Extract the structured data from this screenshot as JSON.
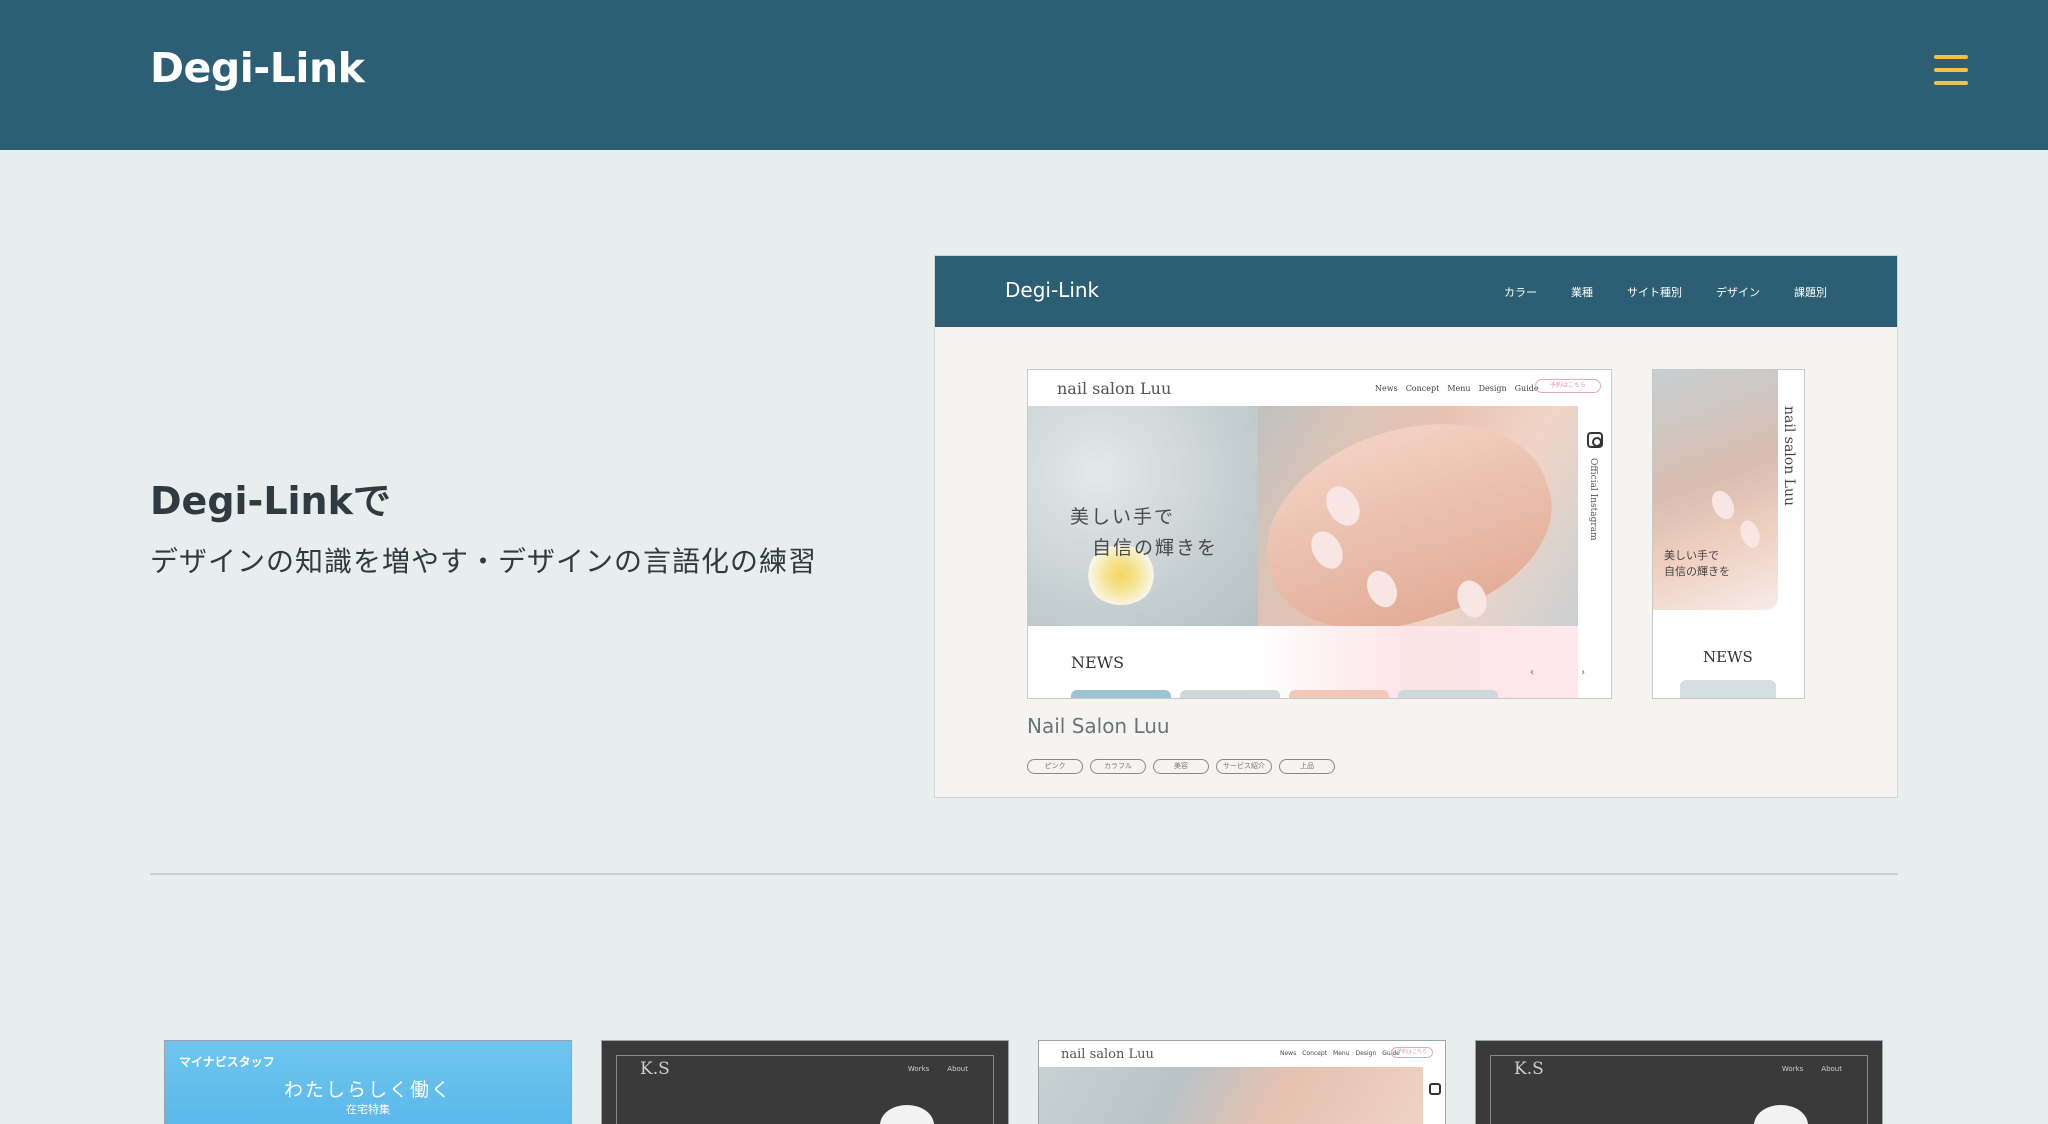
{
  "header": {
    "logo": "Degi-Link",
    "menu_icon": "hamburger-menu-icon",
    "accent_color": "#f0c04a",
    "background_color": "#2c5f74"
  },
  "hero": {
    "title": "Degi-Linkで",
    "subtitle": "デザインの知識を増やす・デザインの言語化の練習"
  },
  "mockup": {
    "site_logo": "Degi-Link",
    "nav": [
      "カラー",
      "業種",
      "サイト種別",
      "デザイン",
      "課題別"
    ],
    "desktop": {
      "brand": "nail salon Luu",
      "nav": [
        "News",
        "Concept",
        "Menu",
        "Design",
        "Guide"
      ],
      "reserve": "予約はこちら",
      "catch_line1": "美しい手で",
      "catch_line2": "自信の輝きを",
      "side_text": "Official Instagram",
      "news_label": "NEWS",
      "arrows": "‹ ›"
    },
    "mobile": {
      "vertical_brand": "nail salon Luu",
      "catch_line1": "美しい手で",
      "catch_line2": "自信の輝きを",
      "news_label": "NEWS"
    },
    "caption": "Nail Salon Luu",
    "tags": [
      "ピンク",
      "カラフル",
      "美容",
      "サービス紹介",
      "上品"
    ]
  },
  "cards": [
    {
      "logo": "マイナビスタッフ",
      "title": "わたしらしく働く",
      "sub": "在宅特集"
    },
    {
      "brand": "K.S",
      "nav": [
        "Works",
        "About"
      ]
    },
    {
      "brand": "nail salon Luu",
      "nav": [
        "News",
        "Concept",
        "Menu",
        "Design",
        "Guide"
      ],
      "reserve": "予約はこちら"
    },
    {
      "brand": "K.S",
      "nav": [
        "Works",
        "About"
      ]
    }
  ]
}
